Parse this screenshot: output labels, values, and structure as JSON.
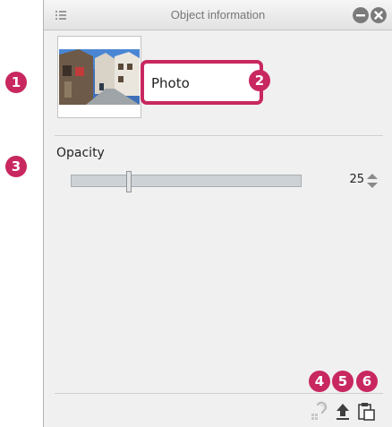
{
  "panel": {
    "title": "Object information",
    "menu_icon": "palette-menu-icon",
    "minimize_icon": "minimize-icon",
    "close_icon": "close-icon"
  },
  "markers": [
    "1",
    "2",
    "3",
    "4",
    "5",
    "6"
  ],
  "object": {
    "thumbnail_icon": "photo-thumbnail",
    "name": "Photo"
  },
  "opacity": {
    "label": "Opacity",
    "value": "25",
    "fraction": 0.25
  },
  "toolbar": {
    "buttons": [
      "link-icon",
      "upload-icon",
      "paste-icon"
    ]
  },
  "colors": {
    "accent": "#c8275f",
    "panel_bg": "#f0f0f0",
    "track": "#cdd2d7"
  }
}
